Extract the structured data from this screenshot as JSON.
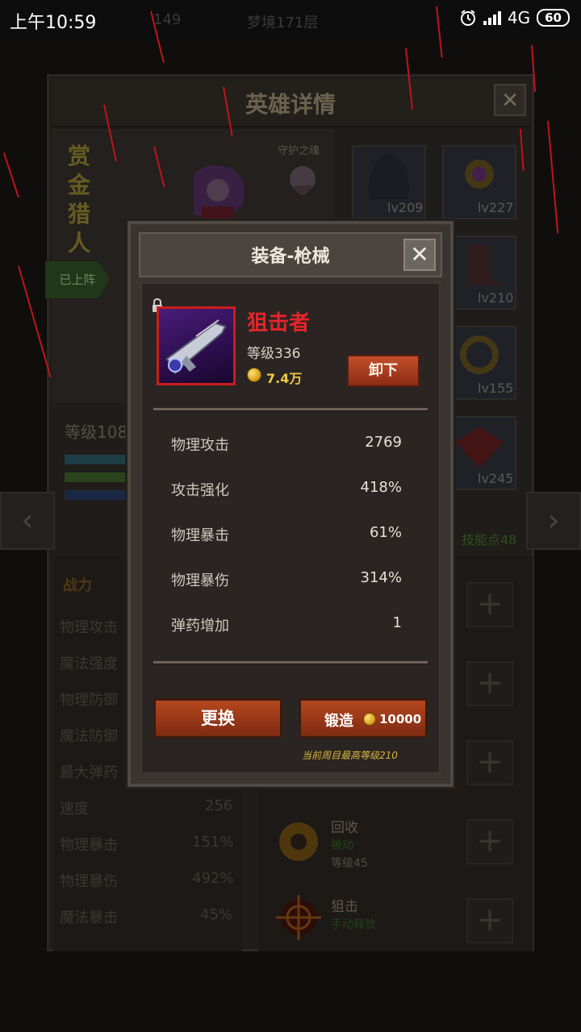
{
  "status_bar": {
    "time": "上午10:59",
    "network": "4G",
    "battery": "60",
    "bg_item_a": "149",
    "bg_floor": "梦境171层"
  },
  "background": {
    "title": "英雄详情",
    "close": "✕",
    "hero_name_chars": [
      "赏",
      "金",
      "猎",
      "人"
    ],
    "guard_label": "守护之魂",
    "deployed": "已上阵",
    "level": "等级108",
    "slots": [
      "lv209",
      "lv227",
      "lv210",
      "lv155",
      "lv245"
    ],
    "skill_points": "技能点48",
    "stats_header": "战力",
    "stats": [
      {
        "name": "物理攻击",
        "value": ""
      },
      {
        "name": "魔法强度",
        "value": ""
      },
      {
        "name": "物理防御",
        "value": ""
      },
      {
        "name": "魔法防御",
        "value": ""
      },
      {
        "name": "最大弹药",
        "value": ""
      },
      {
        "name": "速度",
        "value": "256"
      },
      {
        "name": "物理暴击",
        "value": "151%"
      },
      {
        "name": "物理暴伤",
        "value": "492%"
      },
      {
        "name": "魔法暴击",
        "value": "45%"
      }
    ],
    "skills": [
      {
        "name": "回收",
        "type": "被动",
        "level": "等级45"
      },
      {
        "name": "狙击",
        "type": "手动释放",
        "level": ""
      }
    ],
    "nav_left": "‹",
    "nav_right": "›",
    "plus": "+"
  },
  "modal": {
    "title": "装备-枪械",
    "close": "✕",
    "item": {
      "name": "狙击者",
      "level": "等级336",
      "price": "7.4万",
      "icon": "sniper-rifle-icon"
    },
    "unequip_label": "卸下",
    "stats": [
      {
        "name": "物理攻击",
        "value": "2769"
      },
      {
        "name": "攻击强化",
        "value": "418%"
      },
      {
        "name": "物理暴击",
        "value": "61%"
      },
      {
        "name": "物理暴伤",
        "value": "314%"
      },
      {
        "name": "弹药增加",
        "value": "1"
      }
    ],
    "replace_label": "更换",
    "forge_label": "锻造",
    "forge_cost": "10000",
    "max_level_note": "当前周目最高等级210"
  },
  "colors": {
    "item_name": "#e8242a",
    "button": "#b5471f",
    "gold": "#f0c744"
  }
}
